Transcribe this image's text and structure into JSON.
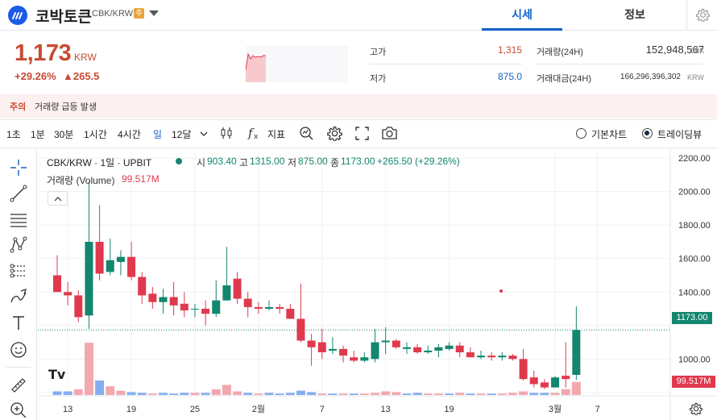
{
  "header": {
    "coin_name": "코박토큰",
    "pair": "CBK/KRW",
    "notice_badge": "주",
    "tabs": [
      {
        "label": "시세",
        "active": true
      },
      {
        "label": "정보",
        "active": false
      }
    ]
  },
  "price": {
    "current": "1,173",
    "unit": "KRW",
    "change_pct": "+29.26%",
    "change_amt": "▲265.5",
    "high_label": "고가",
    "high": "1,315",
    "low_label": "저가",
    "low": "875.0",
    "volume_label": "거래량(24H)",
    "volume": "152,948,567",
    "volume_unit": "CBK",
    "amount_label": "거래대금(24H)",
    "amount": "166,296,396,302",
    "amount_unit": "KRW"
  },
  "warning": {
    "tag": "주의",
    "message": "거래량 급등 발생"
  },
  "toolbar": {
    "intervals": [
      "1초",
      "1분",
      "30분",
      "1시간",
      "4시간",
      "일",
      "12달"
    ],
    "selected_interval": "일",
    "indicator_label": "지표",
    "basic_chart": "기본차트",
    "trading_view": "트레이딩뷰",
    "selected_view": "트레이딩뷰"
  },
  "chart_legend": {
    "symbol": "CBK/KRW · 1일 · UPBIT",
    "open_label": "시",
    "open": "903.40",
    "high_label": "고",
    "high": "1315.00",
    "low_label": "저",
    "low": "875.00",
    "close_label": "종",
    "close": "1173.00",
    "change": "+265.50 (+29.26%)",
    "volume_label": "거래량 (Volume)",
    "volume_value": "99.517M"
  },
  "colors": {
    "up": "#12866e",
    "down": "#e0394d",
    "vol_up": "#f2a9ae",
    "vol_down": "#85aef2",
    "accent": "#1261c4",
    "price_red": "#c84a31"
  },
  "chart_data": {
    "type": "candlestick",
    "y_ticks": [
      "2200.00",
      "2000.00",
      "1800.00",
      "1600.00",
      "1400.00",
      "1000.00"
    ],
    "ylim": [
      780,
      2220
    ],
    "x_ticks": [
      {
        "label": "13",
        "index": 1
      },
      {
        "label": "19",
        "index": 7
      },
      {
        "label": "25",
        "index": 13
      },
      {
        "label": "2월",
        "index": 19
      },
      {
        "label": "7",
        "index": 25
      },
      {
        "label": "13",
        "index": 31
      },
      {
        "label": "19",
        "index": 37
      },
      {
        "label": "3월",
        "index": 47
      },
      {
        "label": "7",
        "index": 51
      }
    ],
    "last_price_label": "1173.00",
    "last_price": 1173,
    "volume_last_label": "99.517M",
    "candles": [
      [
        1500,
        1400,
        1400,
        1620
      ],
      [
        1400,
        1380,
        1320,
        1460
      ],
      [
        1380,
        1250,
        1220,
        1410
      ],
      [
        1260,
        1700,
        1180,
        2060
      ],
      [
        1700,
        1510,
        1470,
        1920
      ],
      [
        1520,
        1590,
        1500,
        1720
      ],
      [
        1580,
        1610,
        1500,
        1650
      ],
      [
        1610,
        1490,
        1470,
        1700
      ],
      [
        1490,
        1380,
        1330,
        1520
      ],
      [
        1390,
        1340,
        1300,
        1430
      ],
      [
        1340,
        1370,
        1270,
        1420
      ],
      [
        1370,
        1320,
        1260,
        1460
      ],
      [
        1330,
        1290,
        1250,
        1400
      ],
      [
        1300,
        1300,
        1250,
        1330
      ],
      [
        1300,
        1270,
        1200,
        1350
      ],
      [
        1270,
        1350,
        1250,
        1470
      ],
      [
        1350,
        1440,
        1350,
        1670
      ],
      [
        1480,
        1360,
        1330,
        1520
      ],
      [
        1360,
        1310,
        1250,
        1400
      ],
      [
        1310,
        1300,
        1270,
        1340
      ],
      [
        1300,
        1310,
        1290,
        1350
      ],
      [
        1310,
        1300,
        1270,
        1330
      ],
      [
        1300,
        1240,
        1240,
        1330
      ],
      [
        1240,
        1110,
        1100,
        1450
      ],
      [
        1110,
        1070,
        960,
        1150
      ],
      [
        1100,
        1040,
        1000,
        1180
      ],
      [
        1050,
        1060,
        1030,
        1130
      ],
      [
        1060,
        1020,
        980,
        1080
      ],
      [
        1010,
        990,
        980,
        1050
      ],
      [
        990,
        1010,
        980,
        1040
      ],
      [
        1000,
        1100,
        980,
        1180
      ],
      [
        1100,
        1110,
        1030,
        1190
      ],
      [
        1110,
        1070,
        1060,
        1120
      ],
      [
        1060,
        1070,
        1030,
        1100
      ],
      [
        1070,
        1040,
        1030,
        1090
      ],
      [
        1040,
        1050,
        1030,
        1080
      ],
      [
        1050,
        1070,
        1010,
        1090
      ],
      [
        1060,
        1080,
        1050,
        1100
      ],
      [
        1080,
        1040,
        1010,
        1100
      ],
      [
        1040,
        1010,
        1010,
        1070
      ],
      [
        1010,
        1020,
        1000,
        1050
      ],
      [
        1020,
        1010,
        990,
        1040
      ],
      [
        1010,
        1020,
        990,
        1040
      ],
      [
        1020,
        1000,
        990,
        1030
      ],
      [
        1000,
        880,
        870,
        1060
      ],
      [
        890,
        850,
        830,
        930
      ],
      [
        860,
        830,
        820,
        880
      ],
      [
        830,
        890,
        830,
        900
      ],
      [
        900,
        880,
        830,
        1100
      ],
      [
        905,
        1173,
        875,
        1315
      ]
    ],
    "volumes": [
      [
        0.05,
        "down"
      ],
      [
        0.05,
        "down"
      ],
      [
        0.08,
        "up"
      ],
      [
        0.72,
        "up"
      ],
      [
        0.2,
        "down"
      ],
      [
        0.12,
        "up"
      ],
      [
        0.06,
        "up"
      ],
      [
        0.04,
        "down"
      ],
      [
        0.03,
        "down"
      ],
      [
        0.02,
        "up"
      ],
      [
        0.03,
        "down"
      ],
      [
        0.02,
        "down"
      ],
      [
        0.03,
        "down"
      ],
      [
        0.03,
        "up"
      ],
      [
        0.03,
        "down"
      ],
      [
        0.08,
        "up"
      ],
      [
        0.14,
        "up"
      ],
      [
        0.05,
        "up"
      ],
      [
        0.03,
        "down"
      ],
      [
        0.02,
        "up"
      ],
      [
        0.03,
        "down"
      ],
      [
        0.02,
        "down"
      ],
      [
        0.03,
        "down"
      ],
      [
        0.06,
        "down"
      ],
      [
        0.04,
        "down"
      ],
      [
        0.02,
        "up"
      ],
      [
        0.02,
        "down"
      ],
      [
        0.02,
        "up"
      ],
      [
        0.02,
        "down"
      ],
      [
        0.02,
        "up"
      ],
      [
        0.03,
        "up"
      ],
      [
        0.05,
        "up"
      ],
      [
        0.04,
        "up"
      ],
      [
        0.02,
        "down"
      ],
      [
        0.03,
        "down"
      ],
      [
        0.02,
        "up"
      ],
      [
        0.02,
        "up"
      ],
      [
        0.02,
        "down"
      ],
      [
        0.03,
        "up"
      ],
      [
        0.02,
        "down"
      ],
      [
        0.02,
        "up"
      ],
      [
        0.02,
        "down"
      ],
      [
        0.02,
        "up"
      ],
      [
        0.03,
        "up"
      ],
      [
        0.05,
        "up"
      ],
      [
        0.03,
        "down"
      ],
      [
        0.03,
        "down"
      ],
      [
        0.03,
        "up"
      ],
      [
        0.08,
        "up"
      ],
      [
        0.18,
        "up"
      ]
    ]
  }
}
